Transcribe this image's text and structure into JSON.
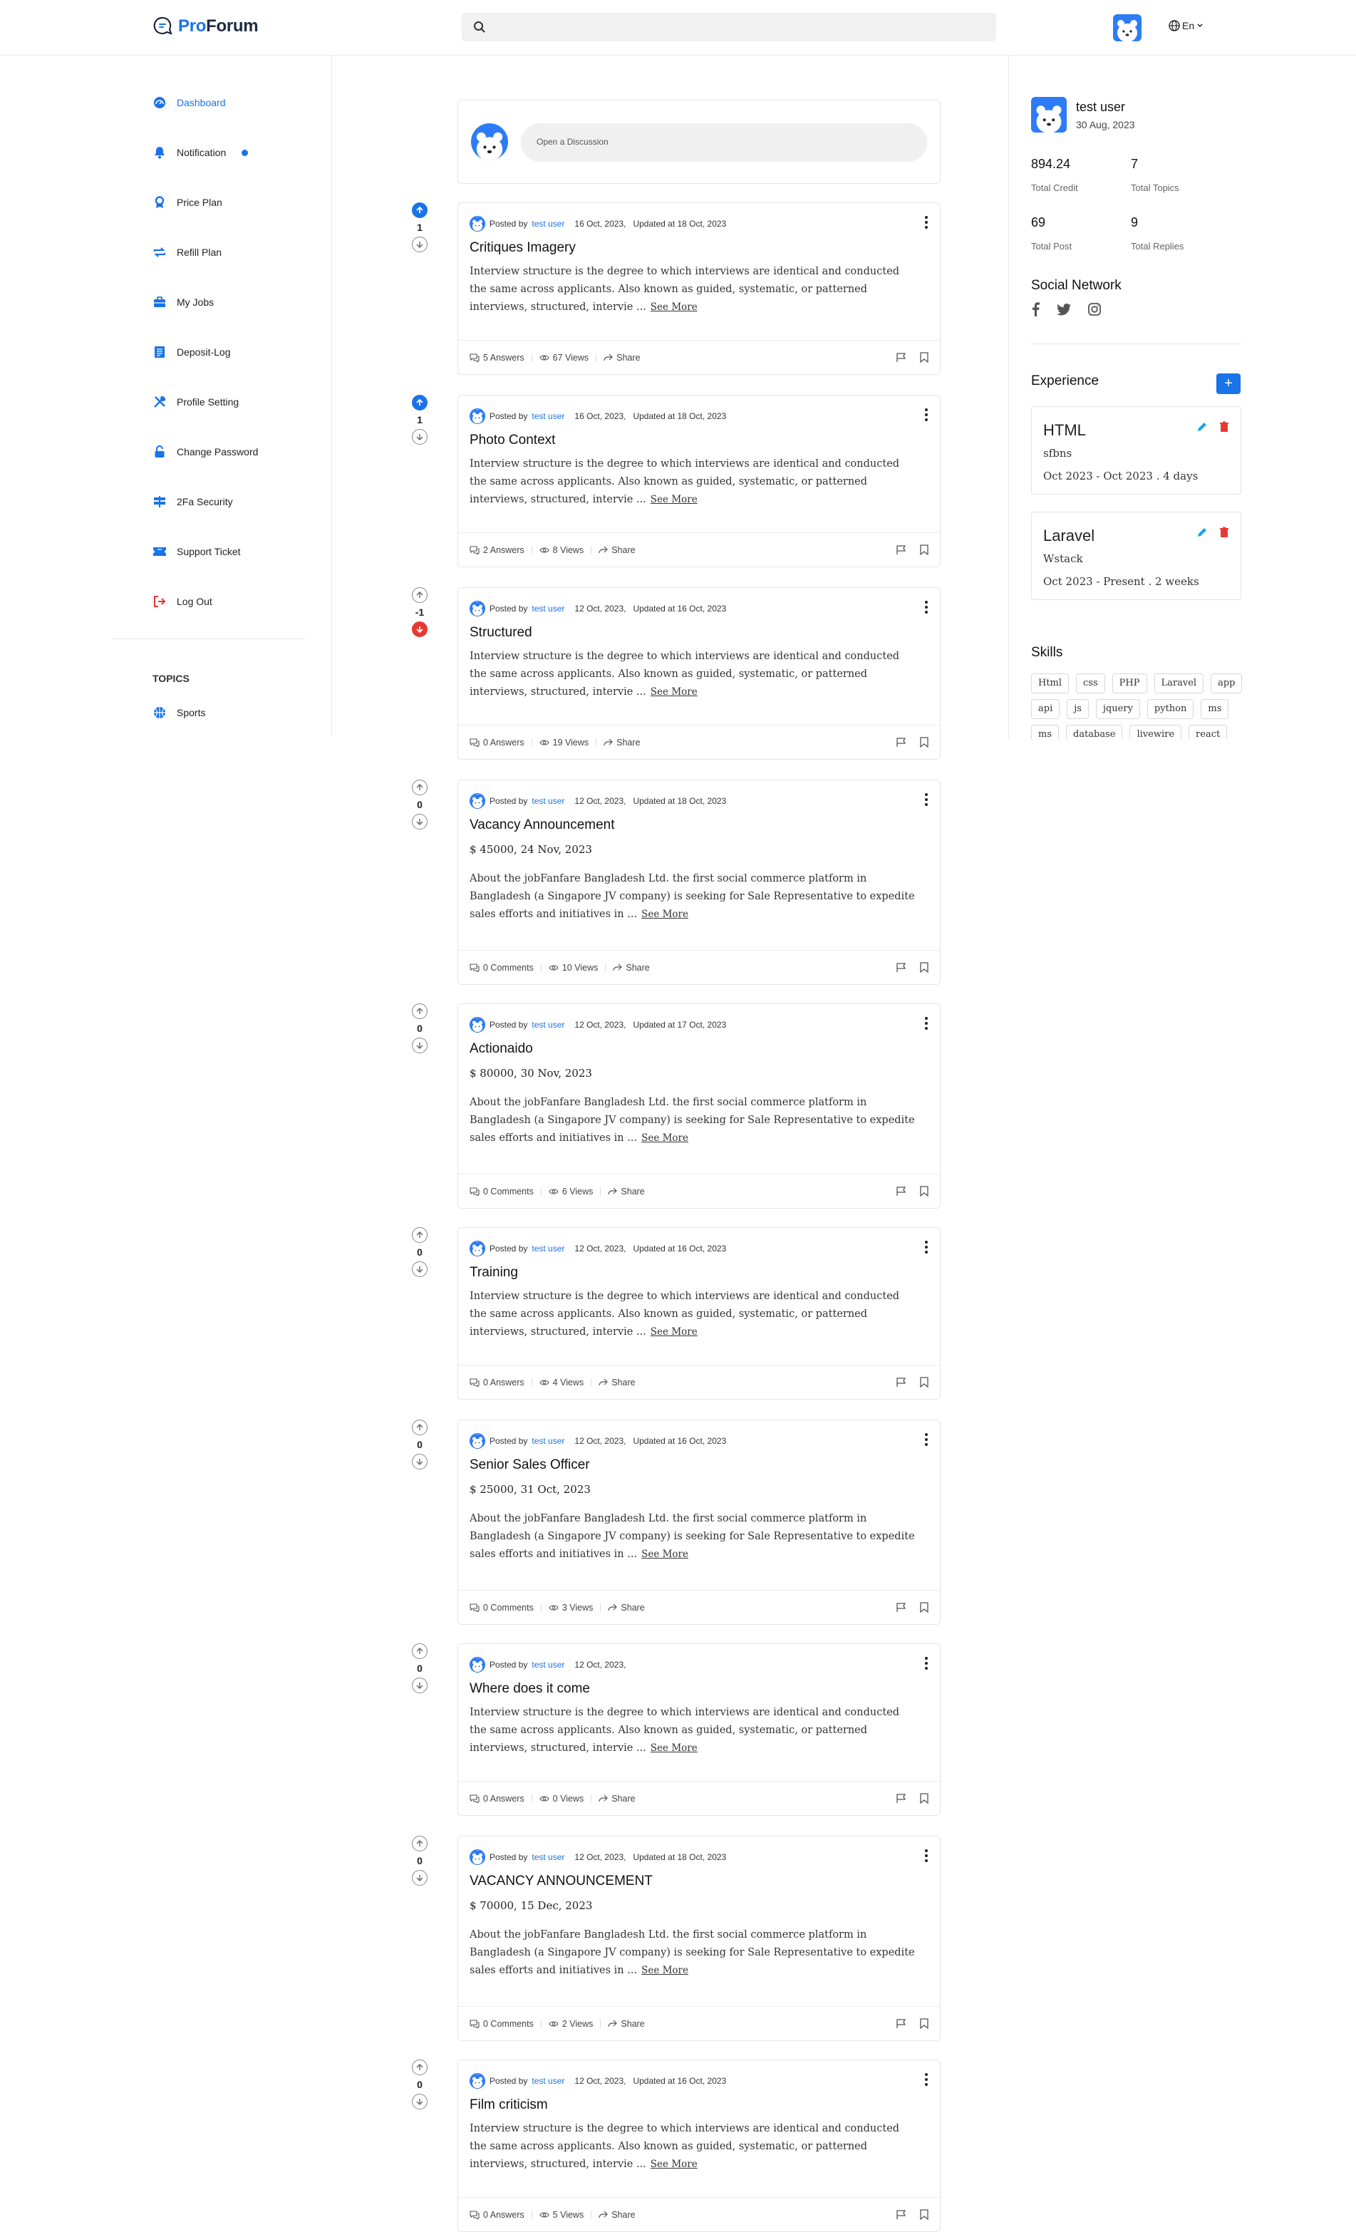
{
  "brand": {
    "name_prefix": "Pro",
    "name_suffix": "Forum",
    "accent": "#1a73e8"
  },
  "header": {
    "search_placeholder": "",
    "language": "En"
  },
  "sidebar": {
    "items": [
      {
        "label": "Dashboard",
        "icon": "dashboard-icon",
        "active": true
      },
      {
        "label": "Notification",
        "icon": "bell-icon"
      },
      {
        "label": "Price Plan",
        "icon": "award-icon"
      },
      {
        "label": "Refill Plan",
        "icon": "repeat-icon"
      },
      {
        "label": "My Jobs",
        "icon": "briefcase-icon"
      },
      {
        "label": "Deposit-Log",
        "icon": "receipt-icon"
      },
      {
        "label": "Profile Setting",
        "icon": "tools-icon"
      },
      {
        "label": "Change Password",
        "icon": "lock-icon"
      },
      {
        "label": "2Fa Security",
        "icon": "signpost-icon"
      },
      {
        "label": "Support Ticket",
        "icon": "ticket-icon"
      },
      {
        "label": "Log Out",
        "icon": "logout-icon"
      }
    ],
    "topics_heading": "TOPICS",
    "topics": [
      {
        "label": "Sports",
        "icon": "basketball-icon"
      }
    ]
  },
  "compose": {
    "placeholder": "Open a Discussion"
  },
  "posts": [
    {
      "votes": "1",
      "vote_state": "up",
      "posted_by": "Posted by",
      "author": "test user",
      "date": "16 Oct, 2023,",
      "updated": "Updated at 18 Oct, 2023",
      "title": "Critiques Imagery",
      "body": "Interview structure is the degree to which interviews are identical and conducted the same across applicants. Also known as guided, systematic, or patterned interviews, structured, intervie ...",
      "see_more": "See More",
      "count": "5 Answers",
      "views": "67 Views",
      "share": "Share"
    },
    {
      "votes": "1",
      "vote_state": "up",
      "posted_by": "Posted by",
      "author": "test user",
      "date": "16 Oct, 2023,",
      "updated": "Updated at 18 Oct, 2023",
      "title": "Photo Context",
      "body": "Interview structure is the degree to which interviews are identical and conducted the same across applicants. Also known as guided, systematic, or patterned interviews, structured, intervie ...",
      "see_more": "See More",
      "count": "2 Answers",
      "views": "8 Views",
      "share": "Share"
    },
    {
      "votes": "-1",
      "vote_state": "down",
      "posted_by": "Posted by",
      "author": "test user",
      "date": "12 Oct, 2023,",
      "updated": "Updated at 16 Oct, 2023",
      "title": "Structured",
      "body": "Interview structure is the degree to which interviews are identical and conducted the same across applicants. Also known as guided, systematic, or patterned interviews, structured, intervie ...",
      "see_more": "See More",
      "count": "0 Answers",
      "views": "19 Views",
      "share": "Share"
    },
    {
      "votes": "0",
      "vote_state": "none",
      "posted_by": "Posted by",
      "author": "test user",
      "date": "12 Oct, 2023,",
      "updated": "Updated at 18 Oct, 2023",
      "title": "Vacancy Announcement",
      "price": "$ 45000,  24 Nov, 2023",
      "body": "About the jobFanfare Bangladesh Ltd. the first social commerce platform in Bangladesh (a Singapore JV company) is seeking for Sale Representative to expedite sales efforts and initiatives in ...",
      "see_more": "See More",
      "count": "0 Comments",
      "views": "10 Views",
      "share": "Share"
    },
    {
      "votes": "0",
      "vote_state": "none",
      "posted_by": "Posted by",
      "author": "test user",
      "date": "12 Oct, 2023,",
      "updated": "Updated at 17 Oct, 2023",
      "title": "Actionaido",
      "price": "$ 80000,  30 Nov, 2023",
      "body": "About the jobFanfare Bangladesh Ltd. the first social commerce platform in Bangladesh (a Singapore JV company) is seeking for Sale Representative to expedite sales efforts and initiatives in ...",
      "see_more": "See More",
      "count": "0 Comments",
      "views": "6 Views",
      "share": "Share"
    },
    {
      "votes": "0",
      "vote_state": "none",
      "posted_by": "Posted by",
      "author": "test user",
      "date": "12 Oct, 2023,",
      "updated": "Updated at 16 Oct, 2023",
      "title": "Training",
      "body": "Interview structure is the degree to which interviews are identical and conducted the same across applicants. Also known as guided, systematic, or patterned interviews, structured, intervie ...",
      "see_more": "See More",
      "count": "0 Answers",
      "views": "4 Views",
      "share": "Share"
    },
    {
      "votes": "0",
      "vote_state": "none",
      "posted_by": "Posted by",
      "author": "test user",
      "date": "12 Oct, 2023,",
      "updated": "Updated at 16 Oct, 2023",
      "title": "Senior Sales Officer",
      "price": "$ 25000,  31 Oct, 2023",
      "body": "About the jobFanfare Bangladesh Ltd. the first social commerce platform in Bangladesh (a Singapore JV company) is seeking for Sale Representative to expedite sales efforts and initiatives in ...",
      "see_more": "See More",
      "count": "0 Comments",
      "views": "3 Views",
      "share": "Share"
    },
    {
      "votes": "0",
      "vote_state": "none",
      "posted_by": "Posted by",
      "author": "test user",
      "date": "12 Oct, 2023,",
      "updated": "",
      "title": "Where does it come",
      "body": "Interview structure is the degree to which interviews are identical and conducted the same across applicants. Also known as guided, systematic, or patterned interviews, structured, intervie ...",
      "see_more": "See More",
      "count": "0 Answers",
      "views": "0 Views",
      "share": "Share"
    },
    {
      "votes": "0",
      "vote_state": "none",
      "posted_by": "Posted by",
      "author": "test user",
      "date": "12 Oct, 2023,",
      "updated": "Updated at 18 Oct, 2023",
      "title": "VACANCY ANNOUNCEMENT",
      "price": "$ 70000,  15 Dec, 2023",
      "body": "About the jobFanfare Bangladesh Ltd. the first social commerce platform in Bangladesh (a Singapore JV company) is seeking for Sale Representative to expedite sales efforts and initiatives in ...",
      "see_more": "See More",
      "count": "0 Comments",
      "views": "2 Views",
      "share": "Share"
    },
    {
      "votes": "0",
      "vote_state": "none",
      "posted_by": "Posted by",
      "author": "test user",
      "date": "12 Oct, 2023,",
      "updated": "Updated at 16 Oct, 2023",
      "title": "Film criticism",
      "body": "Interview structure is the degree to which interviews are identical and conducted the same across applicants. Also known as guided, systematic, or patterned interviews, structured, intervie ...",
      "see_more": "See More",
      "count": "0 Answers",
      "views": "5 Views",
      "share": "Share"
    }
  ],
  "profile": {
    "name": "test user",
    "joined": "30 Aug, 2023",
    "stats": [
      {
        "value": "894.24",
        "label": "Total Credit"
      },
      {
        "value": "7",
        "label": "Total Topics"
      },
      {
        "value": "69",
        "label": "Total Post"
      },
      {
        "value": "9",
        "label": "Total Replies"
      }
    ],
    "social_heading": "Social Network",
    "social": [
      "facebook-icon",
      "twitter-icon",
      "instagram-icon"
    ],
    "experience_heading": "Experience",
    "add_label": "+",
    "experience": [
      {
        "title": "HTML",
        "company": "sfbns",
        "period": "Oct 2023 - Oct 2023 . 4 days"
      },
      {
        "title": "Laravel",
        "company": "Wstack",
        "period": "Oct 2023 - Present . 2 weeks"
      }
    ],
    "skills_heading": "Skills",
    "skills": [
      "Html",
      "css",
      "PHP",
      "Laravel",
      "app",
      "api",
      "js",
      "jquery",
      "python",
      "ms",
      "ms",
      "database",
      "livewire",
      "react"
    ]
  }
}
